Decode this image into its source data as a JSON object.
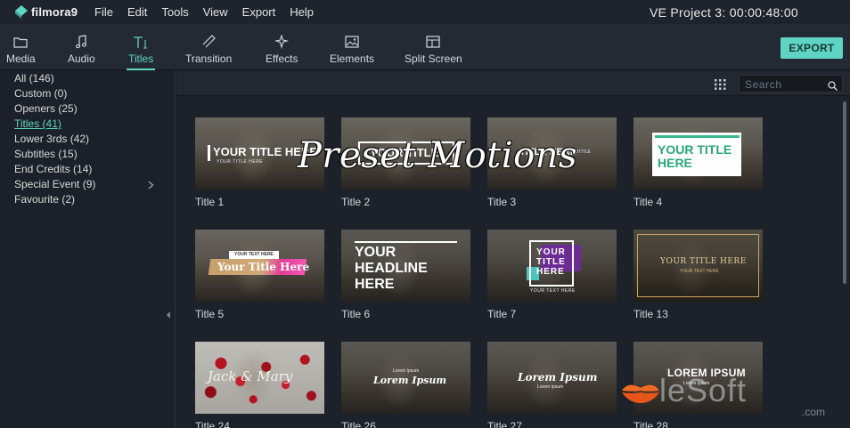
{
  "app": {
    "name": "filmora9",
    "project_title": "VE Project 3:  00:00:48:00"
  },
  "menu": [
    "File",
    "Edit",
    "Tools",
    "View",
    "Export",
    "Help"
  ],
  "toolbar": {
    "tabs": [
      {
        "label": "Media",
        "icon": "folder-icon"
      },
      {
        "label": "Audio",
        "icon": "music-note-icon"
      },
      {
        "label": "Titles",
        "icon": "text-icon"
      },
      {
        "label": "Transition",
        "icon": "transition-icon"
      },
      {
        "label": "Effects",
        "icon": "sparkle-icon"
      },
      {
        "label": "Elements",
        "icon": "image-icon"
      },
      {
        "label": "Split Screen",
        "icon": "split-screen-icon"
      }
    ],
    "active_tab": "Titles",
    "export_label": "EXPORT"
  },
  "sidebar": {
    "items": [
      {
        "label": "All (146)"
      },
      {
        "label": "Custom (0)"
      },
      {
        "label": "Openers (25)"
      },
      {
        "label": "Titles (41)"
      },
      {
        "label": "Lower 3rds (42)"
      },
      {
        "label": "Subtitles (15)"
      },
      {
        "label": "End Credits (14)"
      },
      {
        "label": "Special Event (9)"
      },
      {
        "label": "Favourite (2)"
      }
    ],
    "active_item": "Titles (41)"
  },
  "search": {
    "placeholder": "Search"
  },
  "thumbnails": [
    {
      "caption": "Title 1",
      "overlay": [
        "YOUR TITLE HERE",
        "YOUR TITLE HERE"
      ]
    },
    {
      "caption": "Title 2",
      "overlay": [
        "YOUR TITLE"
      ]
    },
    {
      "caption": "Title 3",
      "overlay": [
        "TITLE HERE",
        "SUBTITLE"
      ]
    },
    {
      "caption": "Title 4",
      "overlay": [
        "YOUR TITLE",
        "HERE"
      ]
    },
    {
      "caption": "Title 5",
      "overlay": [
        "YOUR TEXT HERE",
        "Your Title Here"
      ]
    },
    {
      "caption": "Title 6",
      "overlay": [
        "YOUR",
        "HEADLINE",
        "HERE"
      ]
    },
    {
      "caption": "Title 7",
      "overlay": [
        "YOUR",
        "TITLE",
        "HERE",
        "YOUR TEXT HERE"
      ]
    },
    {
      "caption": "Title 13",
      "overlay": [
        "YOUR TITLE HERE",
        "YOUR TEXT HERE"
      ]
    },
    {
      "caption": "Title 24",
      "overlay": [
        "Jack & Mary"
      ]
    },
    {
      "caption": "Title 26",
      "overlay": [
        "Lorem Ipsum",
        "Lorem Ipsum"
      ]
    },
    {
      "caption": "Title 27",
      "overlay": [
        "Lorem Ipsum",
        "Lorem Ipsum"
      ]
    },
    {
      "caption": "Title 28",
      "overlay": [
        "LOREM IPSUM",
        "Lorem Ipsum"
      ]
    }
  ],
  "watermarks": {
    "center_text": "Preset Motions",
    "brand": "leSoft",
    "brand_suffix": ".com"
  },
  "colors": {
    "accent": "#5fd3c4",
    "bg": "#1c212a",
    "toolbar": "#242a33"
  }
}
